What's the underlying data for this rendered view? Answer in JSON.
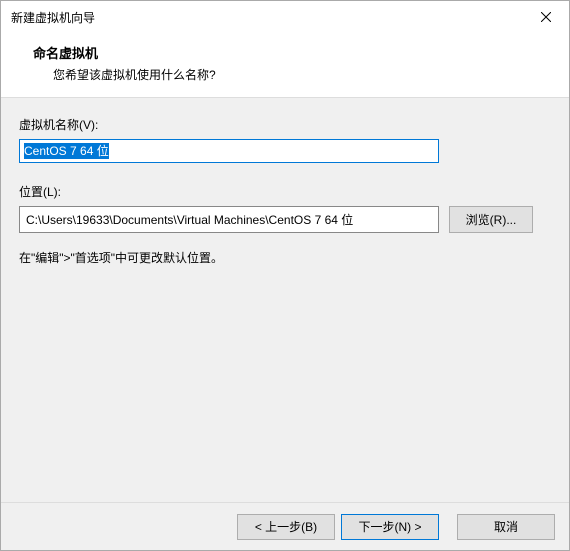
{
  "window": {
    "title": "新建虚拟机向导"
  },
  "header": {
    "title": "命名虚拟机",
    "subtitle": "您希望该虚拟机使用什么名称?"
  },
  "fields": {
    "name_label": "虚拟机名称(V):",
    "name_value": "CentOS 7 64 位",
    "location_label": "位置(L):",
    "location_value": "C:\\Users\\19633\\Documents\\Virtual Machines\\CentOS 7 64 位",
    "browse_label": "浏览(R)..."
  },
  "note": "在\"编辑\">\"首选项\"中可更改默认位置。",
  "buttons": {
    "back": "< 上一步(B)",
    "next": "下一步(N) >",
    "cancel": "取消"
  }
}
